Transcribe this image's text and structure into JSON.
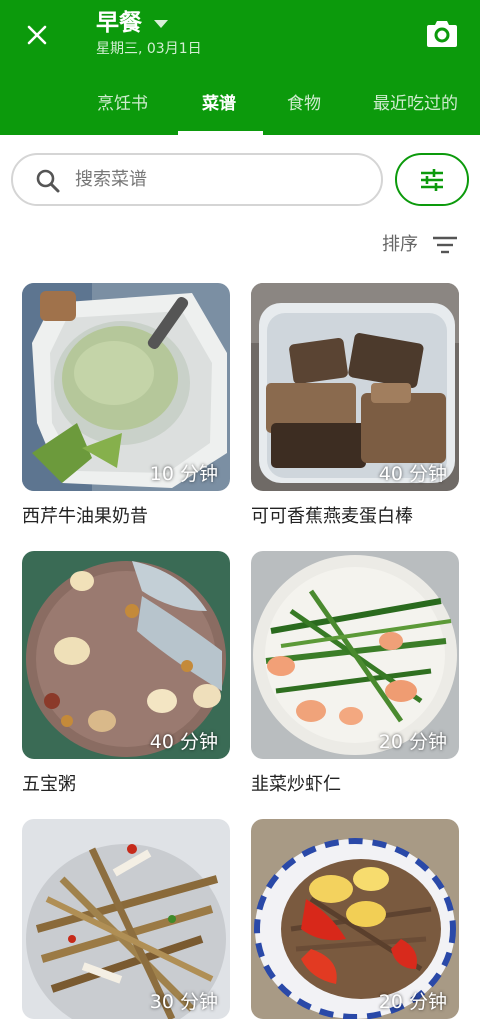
{
  "header": {
    "title": "早餐",
    "subtitle": "星期三, 03月1日",
    "accent_color": "#0c9a0c",
    "close_icon": "close-icon",
    "camera_icon": "camera-icon"
  },
  "tabs": [
    {
      "label": "烹饪书",
      "active": false
    },
    {
      "label": "菜谱",
      "active": true
    },
    {
      "label": "食物",
      "active": false
    },
    {
      "label": "最近吃过的",
      "active": false
    }
  ],
  "search": {
    "placeholder": "搜索菜谱",
    "value": ""
  },
  "sort": {
    "label": "排序"
  },
  "recipes": [
    {
      "title": "西芹牛油果奶昔",
      "time": "10 分钟"
    },
    {
      "title": "可可香蕉燕麦蛋白棒",
      "time": "40 分钟"
    },
    {
      "title": "五宝粥",
      "time": "40 分钟"
    },
    {
      "title": "韭菜炒虾仁",
      "time": "20 分钟"
    },
    {
      "title": "",
      "time": "30 分钟"
    },
    {
      "title": "",
      "time": "20 分钟"
    }
  ]
}
